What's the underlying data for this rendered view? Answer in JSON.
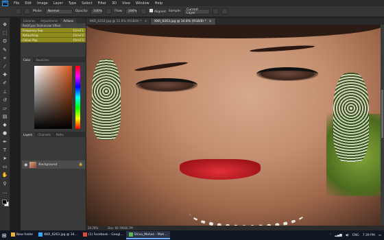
{
  "menubar": {
    "logo": "Ps",
    "items": [
      "File",
      "Edit",
      "Image",
      "Layer",
      "Type",
      "Select",
      "Filter",
      "3D",
      "View",
      "Window",
      "Help"
    ]
  },
  "options": {
    "mode_label": "Mode:",
    "mode_value": "Normal",
    "opacity_label": "Opacity:",
    "opacity_value": "100%",
    "flow_label": "Flow:",
    "flow_value": "100%",
    "aligned_label": "Aligned",
    "sample_label": "Sample:",
    "sample_value": "Current Layer"
  },
  "panels": {
    "top_tabs": [
      "Libraries",
      "Adjustments",
      "Actions"
    ],
    "action_set": "Red/Cyan Technicolor Effect",
    "actions": [
      {
        "name": "Frequency Sep",
        "key": "Ctrl+F1"
      },
      {
        "name": "Retouching",
        "key": "Ctrl+F2"
      },
      {
        "name": "Colour Pop",
        "key": "Ctrl+F3"
      }
    ],
    "color_tabs": [
      "Color",
      "Swatches"
    ],
    "layer_tabs": [
      "Layers",
      "Channels",
      "Paths"
    ],
    "layer_name": "Background"
  },
  "doc_tabs": [
    {
      "label": "KKR_6252.jpg @ 11.6% (RGB/8) *",
      "active": false
    },
    {
      "label": "KKR_6263.jpg @ 34.8% (RGB/8) *",
      "active": true
    }
  ],
  "status": {
    "zoom": "34.78%",
    "doc": "Doc: 60.7M/60.7M"
  },
  "taskbar": {
    "items": [
      {
        "label": "New folder",
        "active": false
      },
      {
        "label": "KKR_6263.jpg @ 34...",
        "active": false
      },
      {
        "label": "(1) Facebook - Googl...",
        "active": false
      },
      {
        "label": "Shiva_Mohan - Mah...",
        "active": true
      }
    ],
    "lang": "ENG",
    "time": "7:39 PM"
  },
  "colors": {
    "accent": "#31a8ff",
    "action_highlight": "#8f8a1c",
    "lip_red": "#d3262f"
  }
}
